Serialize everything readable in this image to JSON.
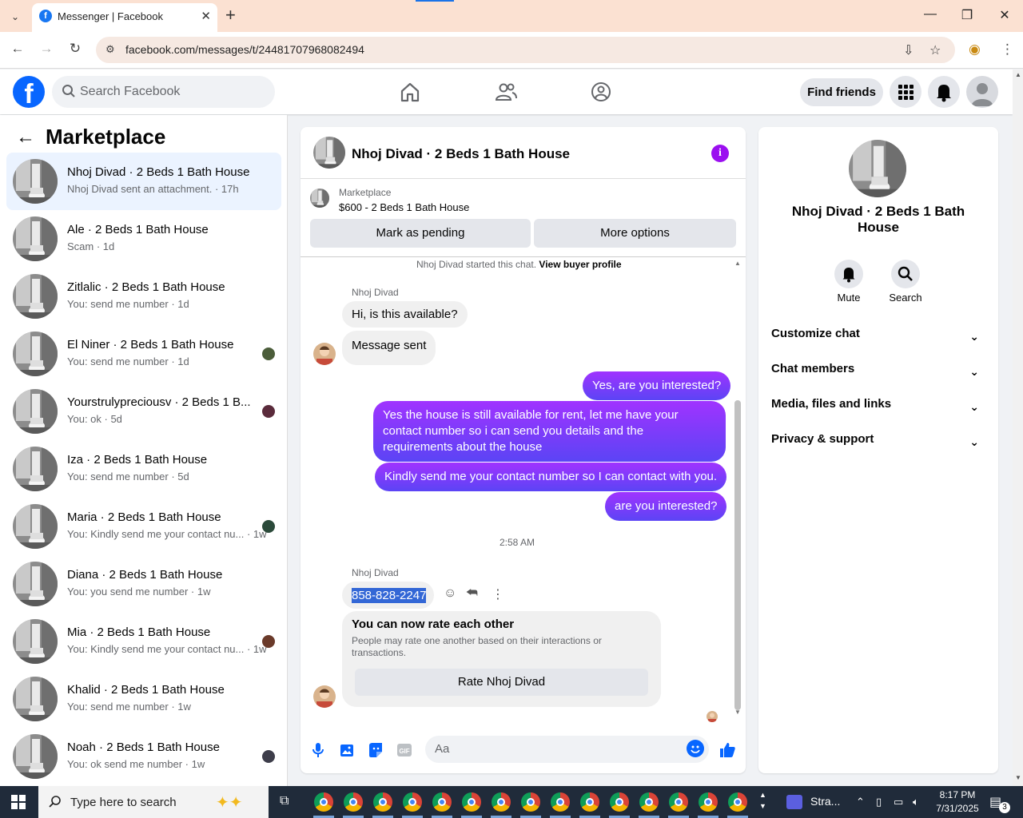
{
  "browser": {
    "tab_title": "Messenger | Facebook",
    "favicon_letter": "f",
    "url": "facebook.com/messages/t/24481707968082494"
  },
  "header": {
    "logo_letter": "f",
    "search_placeholder": "Search Facebook",
    "find_friends": "Find friends"
  },
  "sidebar": {
    "title": "Marketplace",
    "conversations": [
      {
        "name": "Nhoj Divad · 2 Beds 1 Bath House",
        "sub": "Nhoj Divad sent an attachment. · 17h",
        "active": true
      },
      {
        "name": "Ale · 2 Beds 1 Bath House",
        "sub": "Scam · 1d"
      },
      {
        "name": "Zitlalic · 2 Beds 1 Bath House",
        "sub": "You: send me number · 1d"
      },
      {
        "name": "El Niner · 2 Beds 1 Bath House",
        "sub": "You: send me number · 1d"
      },
      {
        "name": "Yourstrulypreciousv · 2 Beds 1 B...",
        "sub": "You: ok · 5d"
      },
      {
        "name": "Iza · 2 Beds 1 Bath House",
        "sub": "You: send me number · 5d"
      },
      {
        "name": "Maria · 2 Beds 1 Bath House",
        "sub": "You: Kindly send me your contact nu... · 1w"
      },
      {
        "name": "Diana · 2 Beds 1 Bath House",
        "sub": "You: you send me number · 1w"
      },
      {
        "name": "Mia · 2 Beds 1 Bath House",
        "sub": "You: Kindly send me your contact nu... · 1w"
      },
      {
        "name": "Khalid · 2 Beds 1 Bath House",
        "sub": "You: send me number · 1w"
      },
      {
        "name": "Noah · 2 Beds 1 Bath House",
        "sub": "You: ok send me number · 1w"
      }
    ]
  },
  "chat": {
    "title": "Nhoj Divad · 2 Beds 1 Bath House",
    "info_icon": "i",
    "marketplace_label": "Marketplace",
    "listing": "$600 - 2 Beds 1 Bath House",
    "mark_pending": "Mark as pending",
    "more_options": "More options",
    "started_text": "Nhoj Divad started this chat.",
    "view_profile": "View buyer profile",
    "sender_name": "Nhoj Divad",
    "msg1": "Hi, is this available?",
    "msg2": "Message sent",
    "out1": "Yes, are you interested?",
    "out2": "Yes the house is still available for rent, let me have your contact number so i can send you details and the requirements about the house",
    "out3": "Kindly send me your contact number so I can contact with you.",
    "out4": "are you interested?",
    "time": "2:58 AM",
    "sender_name2": "Nhoj Divad",
    "phone": "858-828-2247",
    "rate_title": "You can now rate each other",
    "rate_desc": "People may rate one another based on their interactions or transactions.",
    "rate_btn": "Rate Nhoj Divad",
    "composer_placeholder": "Aa"
  },
  "info_panel": {
    "name": "Nhoj Divad · 2 Beds 1 Bath House",
    "mute": "Mute",
    "search": "Search",
    "rows": [
      "Customize chat",
      "Chat members",
      "Media, files and links",
      "Privacy & support"
    ]
  },
  "taskbar": {
    "search_placeholder": "Type here to search",
    "app_label": "Stra...",
    "time": "8:17 PM",
    "date": "7/31/2025",
    "notifications": "3"
  },
  "colors": {
    "brand": "#0866ff",
    "outgoing_bubble": "#7b3ff5",
    "active_conv": "#ebf3ff"
  }
}
